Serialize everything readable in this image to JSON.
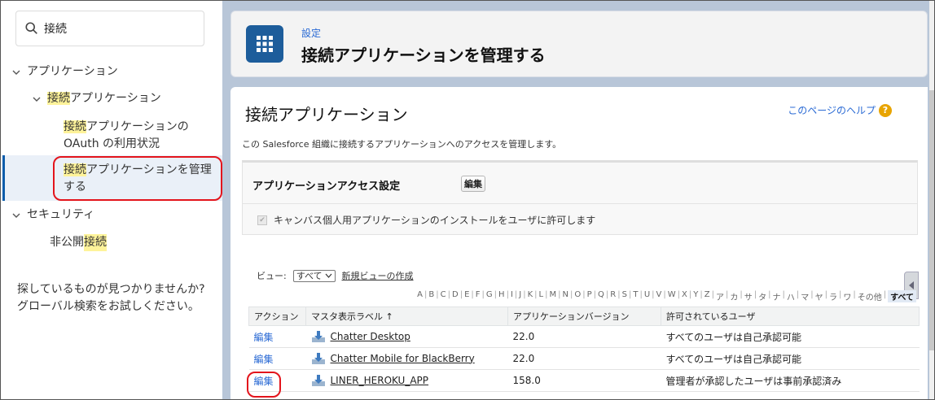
{
  "sidebar": {
    "search_value": "接続",
    "tree": {
      "apps": "アプリケーション",
      "connected_apps_hl": "接続",
      "connected_apps_rest": "アプリケーション",
      "oauth_hl": "接続",
      "oauth_line1_rest": "アプリケーションの",
      "oauth_line2": "OAuth の利用状況",
      "manage_hl": "接続",
      "manage_line1_rest": "アプリケーションを管理",
      "manage_line2": "する",
      "security": "セキュリティ",
      "private_conn_prefix": "非公開",
      "private_conn_hl": "接続"
    },
    "help_text": "探しているものが見つかりませんか? グローバル検索をお試しください。"
  },
  "header": {
    "breadcrumb": "設定",
    "title": "接続アプリケーションを管理する"
  },
  "content": {
    "section_title": "接続アプリケーション",
    "help_link": "このページのヘルプ",
    "description": "この Salesforce 組織に接続するアプリケーションへのアクセスを管理します。",
    "access": {
      "title": "アプリケーションアクセス設定",
      "edit_button": "編集",
      "checkbox_label": "キャンバス個人用アプリケーションのインストールをユーザに許可します",
      "checkbox_checked": true
    },
    "view": {
      "label": "ビュー:",
      "selected": "すべて",
      "create_link": "新規ビューの作成"
    },
    "alpha_filter": [
      "A",
      "B",
      "C",
      "D",
      "E",
      "F",
      "G",
      "H",
      "I",
      "J",
      "K",
      "L",
      "M",
      "N",
      "O",
      "P",
      "Q",
      "R",
      "S",
      "T",
      "U",
      "V",
      "W",
      "X",
      "Y",
      "Z",
      "ア",
      "カ",
      "サ",
      "タ",
      "ナ",
      "ハ",
      "マ",
      "ヤ",
      "ラ",
      "ワ",
      "その他",
      "すべて"
    ],
    "table": {
      "headers": [
        "アクション",
        "マスタ表示ラベル ↑",
        "アプリケーションバージョン",
        "許可されているユーザ"
      ],
      "rows": [
        {
          "action": "編集",
          "label": "Chatter Desktop",
          "version": "22.0",
          "users": "すべてのユーザは自己承認可能"
        },
        {
          "action": "編集",
          "label": "Chatter Mobile for BlackBerry",
          "version": "22.0",
          "users": "すべてのユーザは自己承認可能"
        },
        {
          "action": "編集",
          "label": "LINER_HEROKU_APP",
          "version": "158.0",
          "users": "管理者が承認したユーザは事前承認済み"
        }
      ]
    }
  },
  "colors": {
    "highlight": "#fef39a",
    "link": "#2a6ad4",
    "annotation_red": "#e3141c",
    "app_icon_bg": "#1d5d9b"
  }
}
